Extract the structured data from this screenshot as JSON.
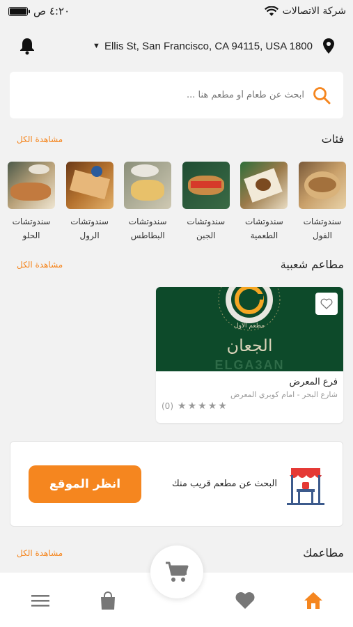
{
  "status_bar": {
    "carrier": "شركة الاتصالات",
    "time": "٤:٢٠ ص"
  },
  "location": {
    "address": "Ellis St, San Francisco, CA 94115, USA 1800"
  },
  "search": {
    "placeholder": "ابحث عن طعام أو مطعم هنا ..."
  },
  "categories_section": {
    "title": "فئات",
    "see_all": "مشاهدة الكل",
    "items": [
      {
        "label": "سندوتشات\nالفول"
      },
      {
        "label": "سندوتشات\nالطعمية"
      },
      {
        "label": "سندوتشات\nالجبن"
      },
      {
        "label": "سندوتشات\nالبطاطس"
      },
      {
        "label": "سندوتشات\nالرول"
      },
      {
        "label": "سندوتشات\nالحلو"
      }
    ]
  },
  "popular_section": {
    "title": "مطاعم شعبية",
    "see_all": "مشاهدة الكل",
    "restaurant": {
      "logo_text_ar": "الجعان",
      "logo_text_en": "ELGA3AN",
      "name": "فرع المعرض",
      "address": "شارع البحر - امام كوبري المعرض",
      "rating_count": "(0)",
      "stars": 0
    }
  },
  "nearby": {
    "text": "البحث عن مطعم قريب منك",
    "button": "انظر الموقع"
  },
  "restaurants_section": {
    "title": "مطاعمك",
    "see_all": "مشاهدة الكل"
  },
  "colors": {
    "accent": "#f5861f",
    "banner_green": "#0d4a2a",
    "background": "#f2f2f2"
  },
  "icons": {
    "nav": [
      "home-icon",
      "heart-icon",
      "cart-icon",
      "bag-icon",
      "menu-icon"
    ]
  }
}
